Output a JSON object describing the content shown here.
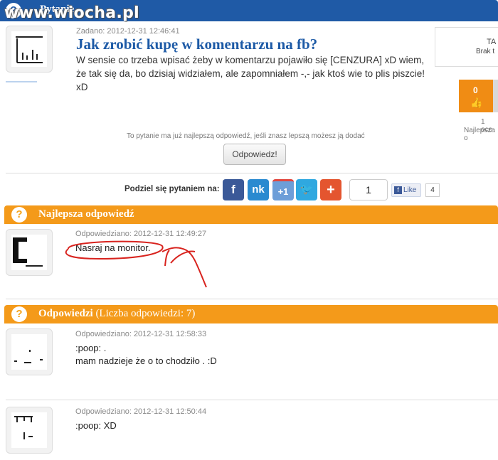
{
  "watermark": "www.wiocha.pl",
  "question_header": {
    "title": "Pytanie"
  },
  "question": {
    "meta": "Zadano: 2012-12-31 12:46:41",
    "title": "Jak zrobić kupę w komentarzu na fb?",
    "body": "W sensie co trzeba wpisać żeby w komentarzu pojawiło się [CENZURA] xD wiem, że tak się da, bo dzisiaj widziałem, ale zapomniałem -,- jak ktoś wie to plis piszcie! xD"
  },
  "side_panel": {
    "label_top": "TA",
    "label_sub": "Brak t",
    "vote_count": "0",
    "rating_note": "1 oce",
    "best_note": "Najlepsza o"
  },
  "best_answer_note": "To pytanie ma już najlepszą odpowiedź, jeśli znasz lepszą możesz ją dodać",
  "answer_button": "Odpowiedz!",
  "share": {
    "label": "Podziel się pytaniem na:",
    "count": "1",
    "like_label": "Like",
    "like_count": "4",
    "icons": [
      "facebook-icon",
      "nk-icon",
      "google-plus-one-icon",
      "twitter-icon",
      "plus-icon"
    ]
  },
  "best_section": {
    "title": "Najlepsza odpowiedź",
    "meta": "Odpowiedziano: 2012-12-31 12:49:27",
    "text": "Nasraj na monitor."
  },
  "answers_section": {
    "title": "Odpowiedzi",
    "count_label": "(Liczba odpowiedzi: 7)"
  },
  "answers": [
    {
      "meta": "Odpowiedziano: 2012-12-31 12:58:33",
      "line1": ":poop: .",
      "line2": "mam nadzieje że o to chodziło . :D"
    },
    {
      "meta": "Odpowiedziano: 2012-12-31 12:50:44",
      "line1": ":poop: XD",
      "line2": ""
    }
  ],
  "colors": {
    "blue": "#1f5aa6",
    "orange": "#f49a1a",
    "annotation_red": "#d8231e"
  }
}
